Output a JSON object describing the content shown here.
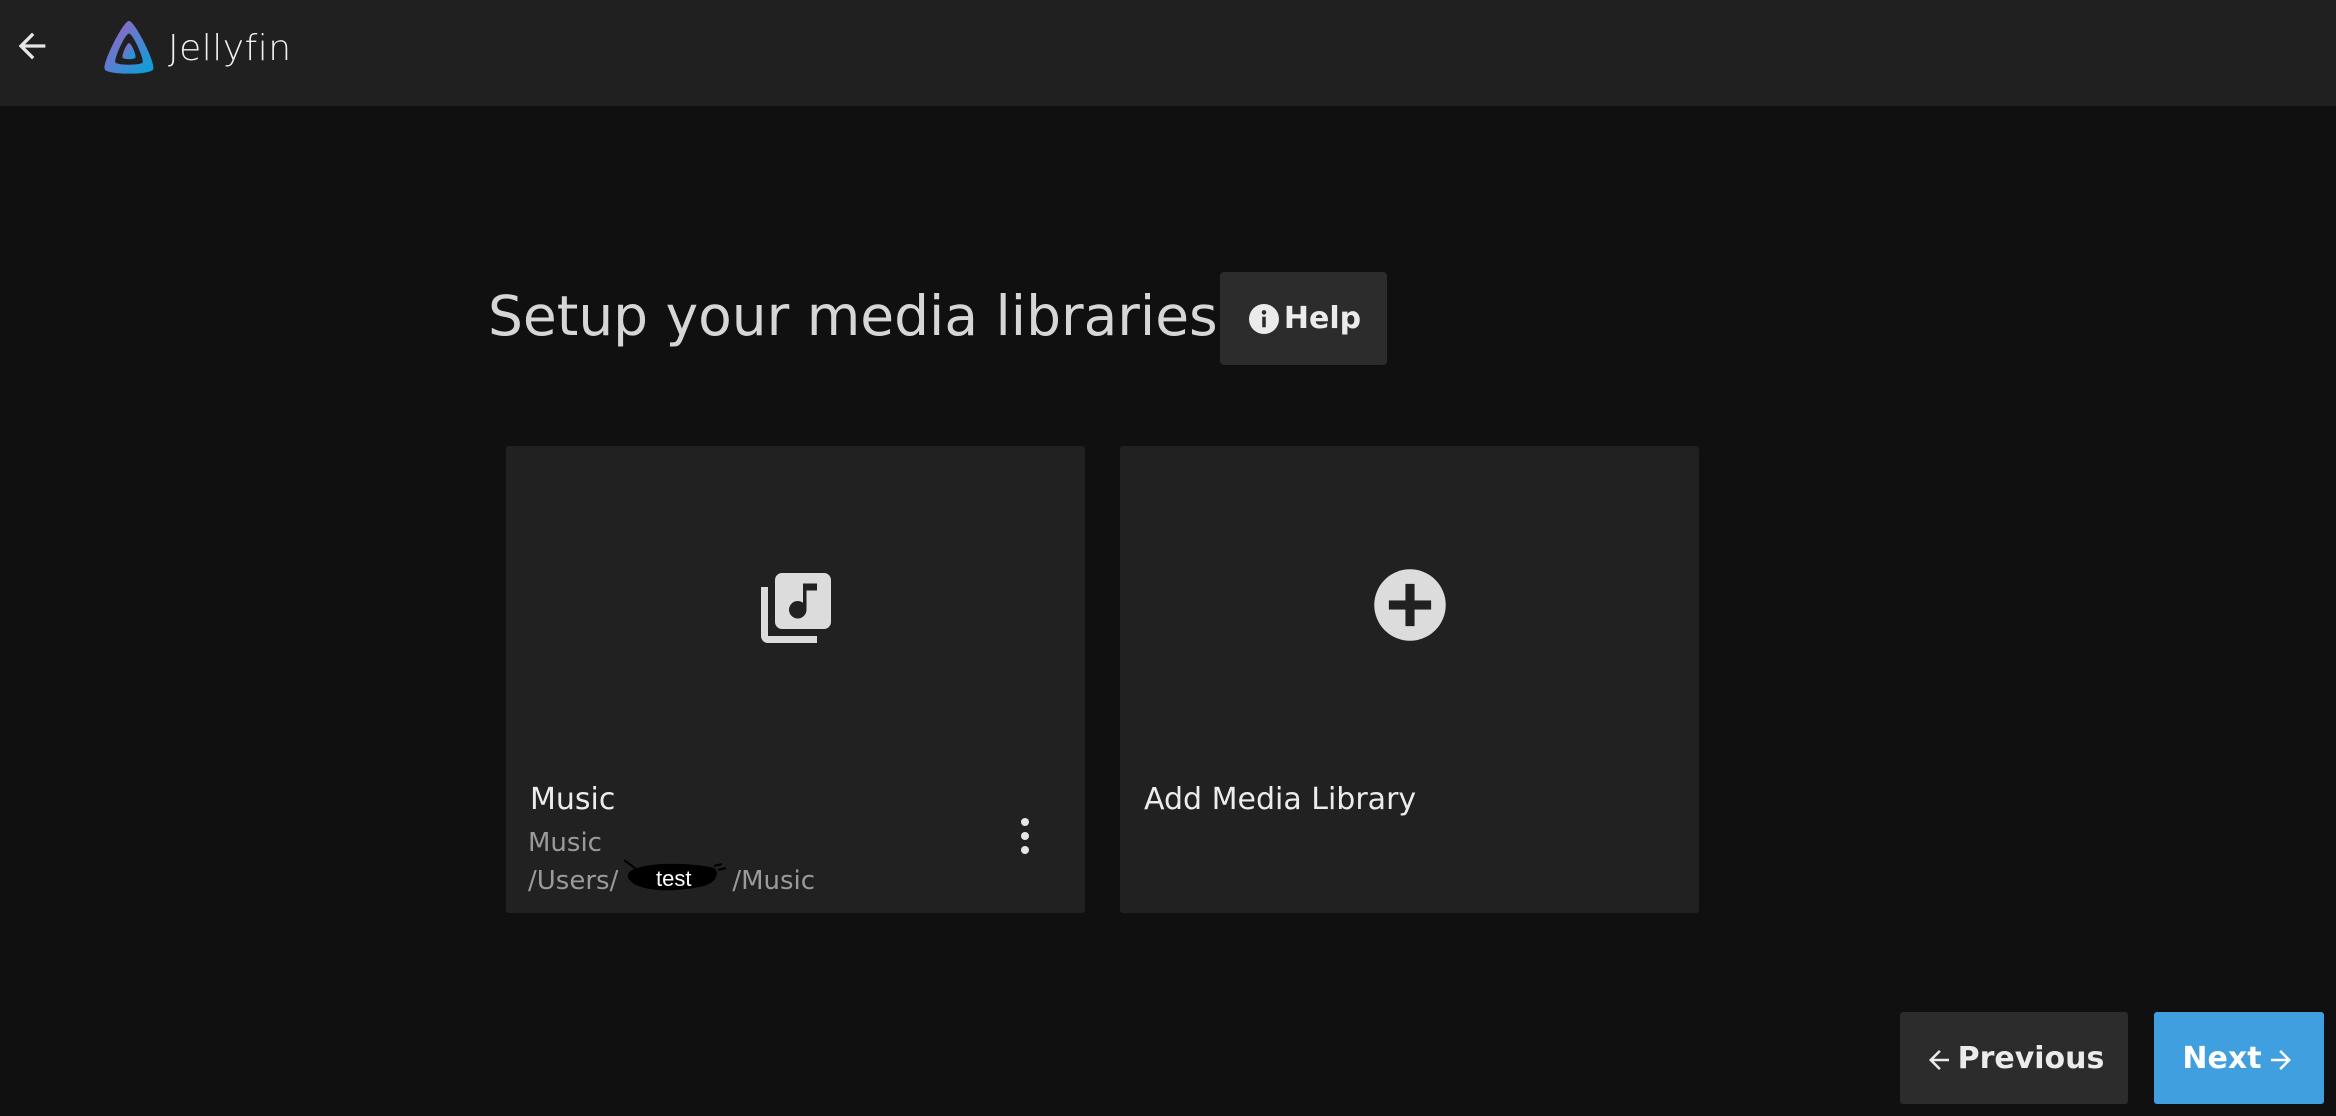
{
  "header": {
    "app_name": "Jellyfin",
    "back_icon": "arrow-left-icon",
    "logo_icon": "jellyfin-logo-icon"
  },
  "page": {
    "title": "Setup your media libraries",
    "help_label": "Help",
    "help_icon": "info-circle-icon"
  },
  "libraries": [
    {
      "name": "Music",
      "type": "Music",
      "path_prefix": "/Users/",
      "path_suffix": "/Music",
      "redacted_label": "test",
      "icon": "music-library-icon",
      "menu_icon": "more-vertical-icon"
    }
  ],
  "add_card": {
    "label": "Add Media Library",
    "icon": "add-circle-icon"
  },
  "footer": {
    "previous_label": "Previous",
    "next_label": "Next"
  },
  "colors": {
    "header_bg": "#202020",
    "page_bg": "#101010",
    "card_bg": "#212121",
    "button_bg": "#2c2c2c",
    "accent": "#3f9fdf"
  }
}
